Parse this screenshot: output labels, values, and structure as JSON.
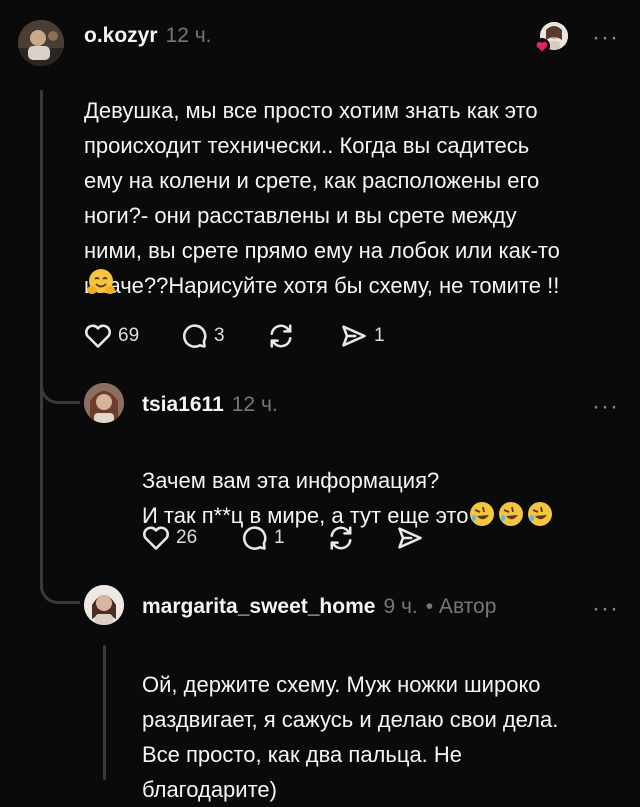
{
  "post": {
    "username": "o.kozyr",
    "time": "12 ч.",
    "text": "Девушка, мы все просто хотим знать как это\nпроисходит технически.. Когда вы садитесь\nему на колени и срете, как расположены его\nноги?- они расставлены и вы срете между\nними, вы срете прямо ему на лобок или как-то\nиначе??Нарисуйте хотя бы схему, не томите !!",
    "likes": "69",
    "comments": "3",
    "shares": "1"
  },
  "reply1": {
    "username": "tsia1611",
    "time": "12 ч.",
    "text": "Зачем вам эта информация?\nИ так п**ц в мире, а тут еще это",
    "likes": "26",
    "comments": "1"
  },
  "reply2": {
    "username": "margarita_sweet_home",
    "time": "9 ч.",
    "author_badge": "• Автор",
    "text": "Ой, держите схему. Муж ножки широко\nраздвигает, я сажусь и делаю свои дела.\nВсе просто, как два пальца. Не\nблагодарите)"
  },
  "colors": {
    "background": "#0a0a0a",
    "text": "#f3f5f7",
    "secondary": "#777777",
    "heart_badge": "#e0245e"
  },
  "icons": [
    "heart-icon",
    "comment-icon",
    "repost-icon",
    "send-icon",
    "more-icon",
    "hug-emoji",
    "rofl-emoji"
  ]
}
